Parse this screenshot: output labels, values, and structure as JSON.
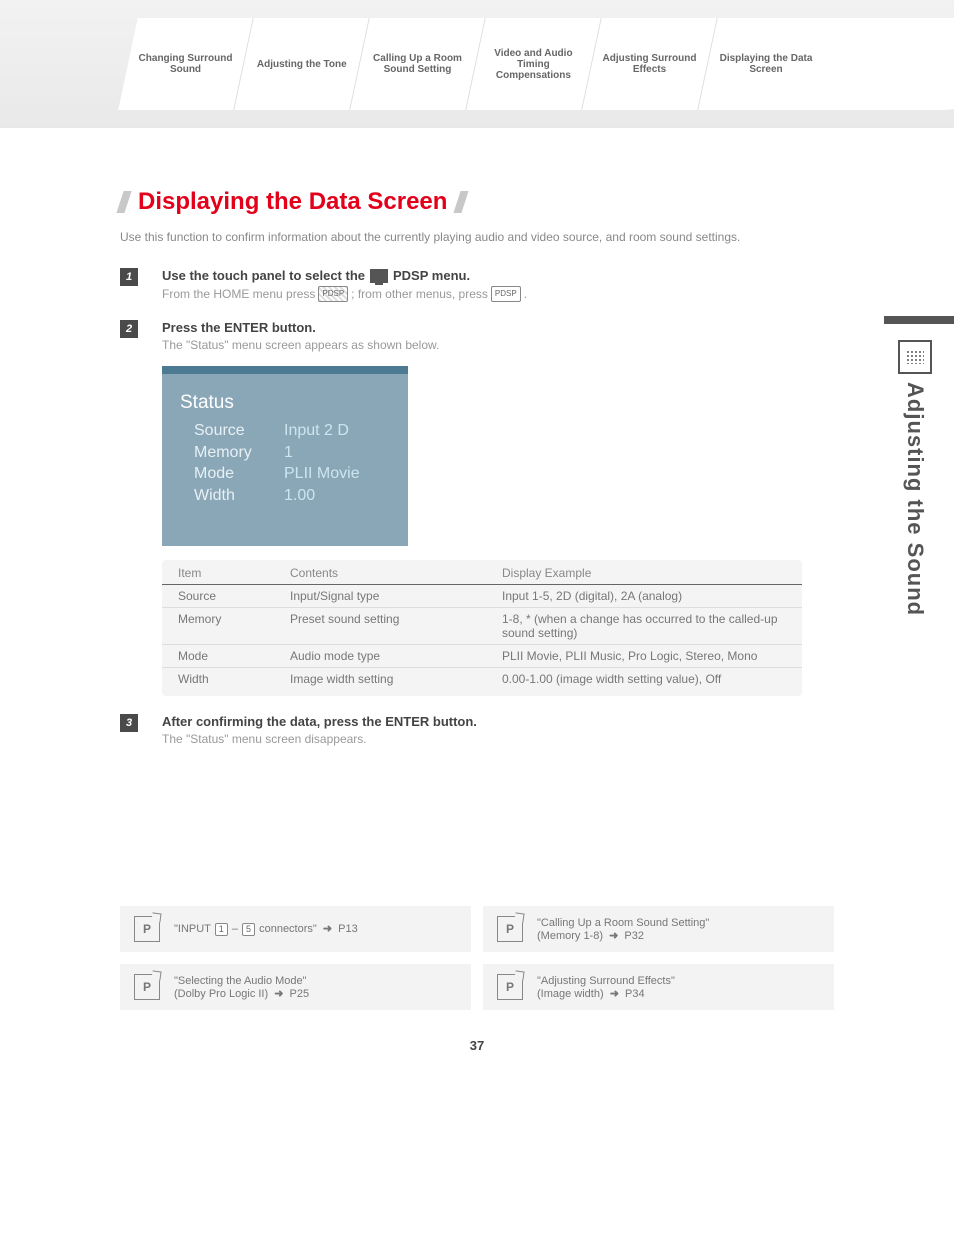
{
  "nav": {
    "tabs": [
      "Changing Surround Sound",
      "Adjusting the Tone",
      "Calling Up a Room Sound Setting",
      "Video and Audio Timing Compensations",
      "Adjusting Surround Effects",
      "Displaying the Data Screen"
    ]
  },
  "title": "Displaying the Data Screen",
  "intro": "Use this function to confirm information about the currently playing audio and video source, and room sound settings.",
  "steps": [
    {
      "n": "1",
      "title_pre": "Use the touch panel to select the",
      "title_post": "PDSP menu.",
      "desc_pre": "From the HOME menu press",
      "desc_btn1": "PDSP",
      "desc_mid": "; from other menus, press",
      "desc_btn2": "PDSP",
      "desc_post": "."
    },
    {
      "n": "2",
      "title": "Press the ENTER button.",
      "desc": "The \"Status\" menu screen appears as shown below."
    },
    {
      "n": "3",
      "title": "After confirming the data, press the ENTER button.",
      "desc": "The \"Status\" menu screen disappears."
    }
  ],
  "status": {
    "title": "Status",
    "rows": [
      {
        "label": "Source",
        "value": "Input 2 D"
      },
      {
        "label": "Memory",
        "value": "1"
      },
      {
        "label": "Mode",
        "value": "PLII Movie"
      },
      {
        "label": "Width",
        "value": "1.00"
      }
    ]
  },
  "table": {
    "headers": [
      "Item",
      "Contents",
      "Display Example"
    ],
    "rows": [
      [
        "Source",
        "Input/Signal type",
        "Input 1-5, 2D (digital), 2A (analog)"
      ],
      [
        "Memory",
        "Preset sound setting",
        "1-8, * (when a change has occurred to the called-up sound setting)"
      ],
      [
        "Mode",
        "Audio mode type",
        "PLII Movie, PLII Music, Pro Logic, Stereo, Mono"
      ],
      [
        "Width",
        "Image width setting",
        "0.00-1.00 (image width setting value), Off"
      ]
    ]
  },
  "side_label": "Adjusting the Sound",
  "refs": [
    {
      "line1_pre": "\"INPUT ",
      "key1": "1",
      "mid": " – ",
      "key2": "5",
      "line1_post": " connectors\"",
      "page": "P13",
      "line2": ""
    },
    {
      "line1": "\"Calling Up a Room Sound Setting\"",
      "line2_pre": "(Memory 1-8)",
      "page": "P32"
    },
    {
      "line1": "\"Selecting the Audio Mode\"",
      "line2_pre": "(Dolby Pro Logic II)",
      "page": "P25"
    },
    {
      "line1": "\"Adjusting Surround Effects\"",
      "line2_pre": "(Image width)",
      "page": "P34"
    }
  ],
  "page_number": "37"
}
